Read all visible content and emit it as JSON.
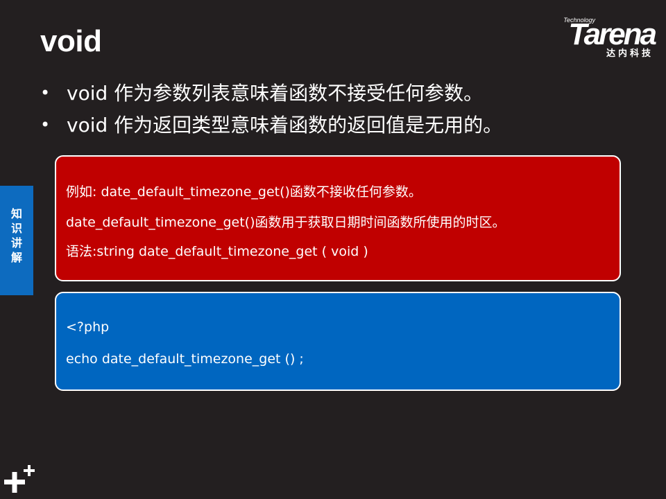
{
  "slide": {
    "title": "void",
    "bullets": [
      "void 作为参数列表意味着函数不接受任何参数。",
      "void 作为返回类型意味着函数的返回值是无用的。"
    ]
  },
  "logo": {
    "technology": "Technology",
    "brand": "Tarena",
    "subtitle": "达内科技"
  },
  "side_tab": {
    "label": [
      "知",
      "识",
      "讲",
      "解"
    ],
    "color": "#0d6bbf"
  },
  "example_box": {
    "color": "#c00000",
    "lines": [
      "例如: date_default_timezone_get()函数不接收任何参数。",
      "date_default_timezone_get()函数用于获取日期时间函数所使用的时区。",
      "语法:string date_default_timezone_get ( void )"
    ]
  },
  "code_box": {
    "color": "#0066c0",
    "lines": [
      "<?php",
      "echo  date_default_timezone_get () ;"
    ]
  },
  "corner_icon": "plus-plus-icon"
}
